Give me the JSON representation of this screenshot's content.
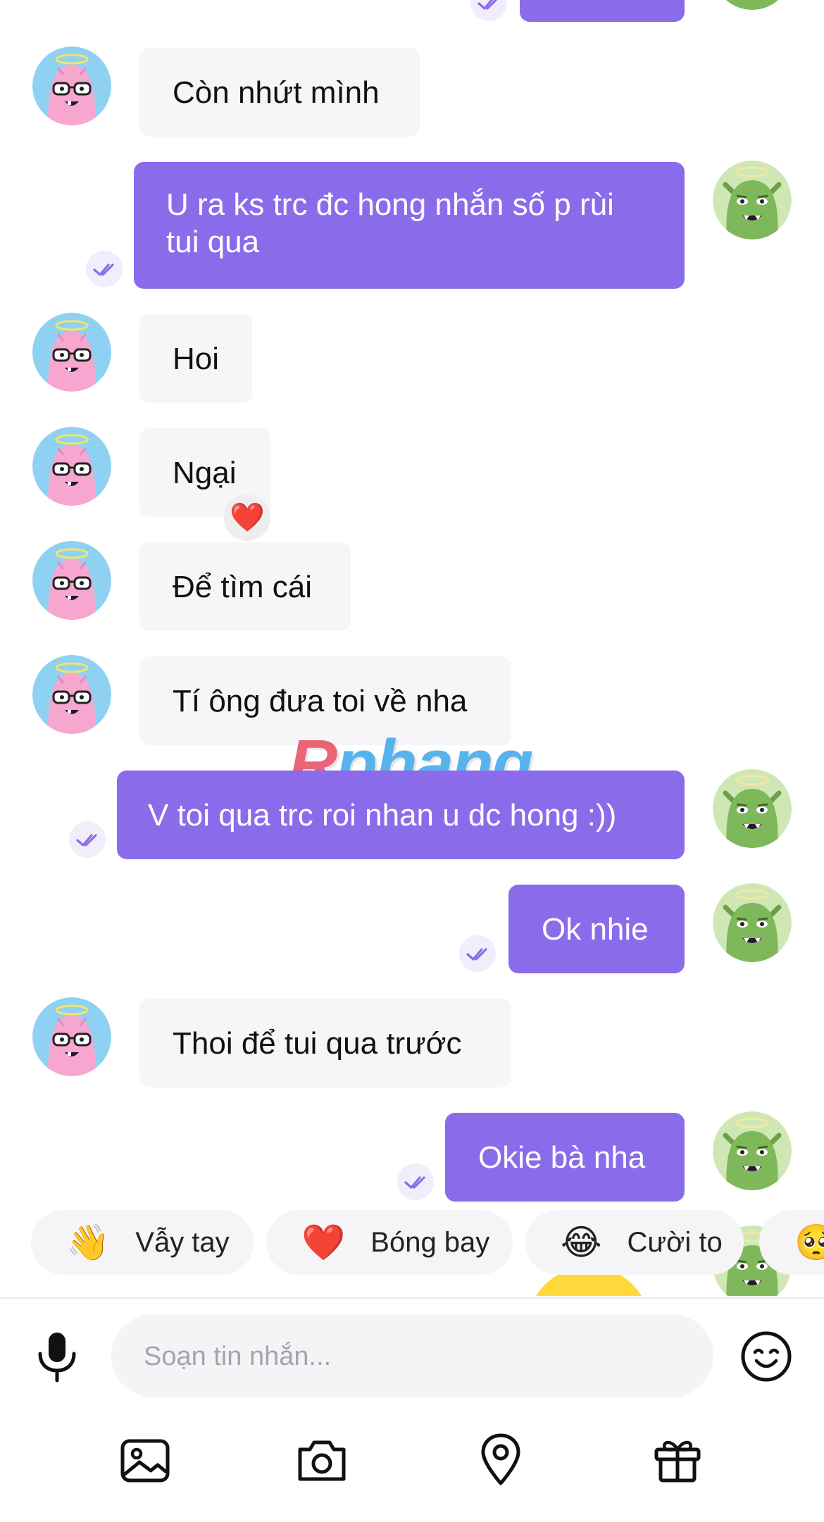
{
  "messages": [
    {
      "text": "Còn nhứt mình"
    },
    {
      "text": "U ra ks trc đc hong nhắn số p rùi tui qua"
    },
    {
      "text": "Hoi"
    },
    {
      "text": "Ngại",
      "reaction": "❤️"
    },
    {
      "text": "Để tìm cái"
    },
    {
      "text": "Tí ông đưa toi về nha"
    },
    {
      "text": "V toi qua trc roi nhan u dc hong :))"
    },
    {
      "text": "Ok nhie"
    },
    {
      "text": "Thoi để tui qua trước"
    },
    {
      "text": "Okie bà nha"
    }
  ],
  "watermark": {
    "first": "R",
    "rest": "phang"
  },
  "quick_reactions": [
    {
      "emoji": "👋",
      "label": "Vẫy tay"
    },
    {
      "emoji": "❤️",
      "label": "Bóng bay"
    },
    {
      "emoji": "😂",
      "label": "Cười to"
    },
    {
      "emoji": "🥺",
      "label": ""
    }
  ],
  "composer": {
    "placeholder": "Soạn tin nhắn..."
  },
  "toolbar": {
    "icons": [
      "microphone-icon",
      "emoji-icon",
      "image-icon",
      "camera-icon",
      "location-icon",
      "gift-icon"
    ]
  },
  "colors": {
    "outgoing_bubble": "#8a6ceb",
    "incoming_bubble": "#f6f6f8",
    "incoming_avatar_bg": "#8fd1f2",
    "outgoing_avatar_bg": "#7fb85a"
  }
}
